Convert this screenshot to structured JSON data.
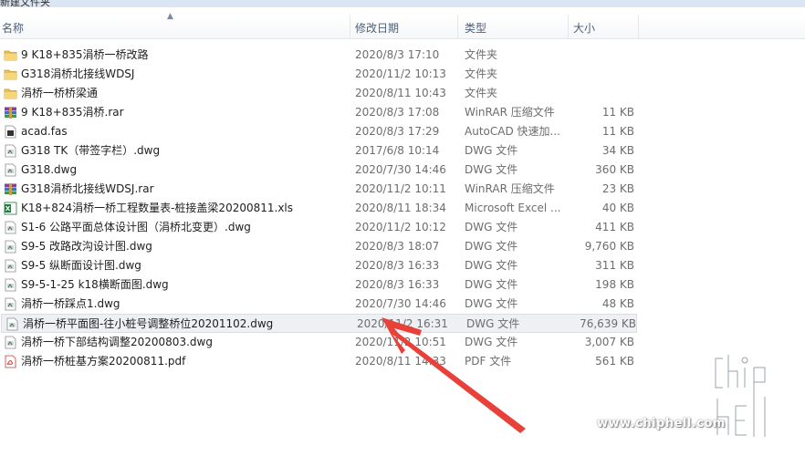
{
  "window": {
    "title": "新建文件夹"
  },
  "header": {
    "name": "名称",
    "date": "修改日期",
    "type": "类型",
    "size": "大小"
  },
  "files": [
    {
      "icon": "folder-icon",
      "name": "9 K18+835涓桥一桥改路",
      "date": "2020/8/3 17:10",
      "type": "文件夹",
      "size": ""
    },
    {
      "icon": "folder-icon",
      "name": "G318涓桥北接线WDSJ",
      "date": "2020/11/2 10:13",
      "type": "文件夹",
      "size": ""
    },
    {
      "icon": "folder-icon",
      "name": "涓桥一桥桥梁通",
      "date": "2020/8/11 10:43",
      "type": "文件夹",
      "size": ""
    },
    {
      "icon": "winrar-icon",
      "name": "9 K18+835涓桥.rar",
      "date": "2020/8/3 17:08",
      "type": "WinRAR 压缩文件",
      "size": "11 KB"
    },
    {
      "icon": "autocad-fas-icon",
      "name": "acad.fas",
      "date": "2020/8/3 17:29",
      "type": "AutoCAD 快速加...",
      "size": "11 KB"
    },
    {
      "icon": "dwg-file-icon",
      "name": "G318 TK（带签字栏）.dwg",
      "date": "2017/6/8 10:14",
      "type": "DWG 文件",
      "size": "34 KB"
    },
    {
      "icon": "dwg-file-icon",
      "name": "G318.dwg",
      "date": "2020/7/30 14:46",
      "type": "DWG 文件",
      "size": "360 KB"
    },
    {
      "icon": "winrar-icon",
      "name": "G318涓桥北接线WDSJ.rar",
      "date": "2020/11/2 10:11",
      "type": "WinRAR 压缩文件",
      "size": "23 KB"
    },
    {
      "icon": "excel-icon",
      "name": "K18+824涓桥一桥工程数量表-桩接盖梁20200811.xls",
      "date": "2020/8/11 18:34",
      "type": "Microsoft Excel ...",
      "size": "40 KB"
    },
    {
      "icon": "dwg-file-icon",
      "name": "S1-6 公路平面总体设计图（涓桥北变更）.dwg",
      "date": "2020/11/2 10:12",
      "type": "DWG 文件",
      "size": "411 KB"
    },
    {
      "icon": "dwg-file-icon",
      "name": "S9-5 改路改沟设计图.dwg",
      "date": "2020/8/3 18:07",
      "type": "DWG 文件",
      "size": "9,760 KB"
    },
    {
      "icon": "dwg-file-icon",
      "name": "S9-5 纵断面设计图.dwg",
      "date": "2020/8/3 16:33",
      "type": "DWG 文件",
      "size": "311 KB"
    },
    {
      "icon": "dwg-file-icon",
      "name": "S9-5-1-25 k18横断面图.dwg",
      "date": "2020/8/3 16:33",
      "type": "DWG 文件",
      "size": "198 KB"
    },
    {
      "icon": "dwg-file-icon",
      "name": "涓桥一桥踩点1.dwg",
      "date": "2020/7/30 14:46",
      "type": "DWG 文件",
      "size": "48 KB"
    },
    {
      "icon": "dwg-file-icon",
      "name": "涓桥一桥平面图-往小桩号调整桥位20201102.dwg",
      "date": "2020/11/2 16:31",
      "type": "DWG 文件",
      "size": "76,639 KB",
      "selected": true
    },
    {
      "icon": "dwg-file-icon",
      "name": "涓桥一桥下部结构调整20200803.dwg",
      "date": "2020/11/2 10:51",
      "type": "DWG 文件",
      "size": "3,007 KB"
    },
    {
      "icon": "pdf-icon",
      "name": "涓桥一桥桩基方案20200811.pdf",
      "date": "2020/8/11 14:33",
      "type": "PDF 文件",
      "size": "561 KB"
    }
  ],
  "watermark": {
    "text": "www.chiphell.com",
    "logo": "chip hell"
  },
  "colors": {
    "selected_bg": "#eef0f3",
    "arrow": "#e8413a",
    "header_text": "#4c607a"
  }
}
